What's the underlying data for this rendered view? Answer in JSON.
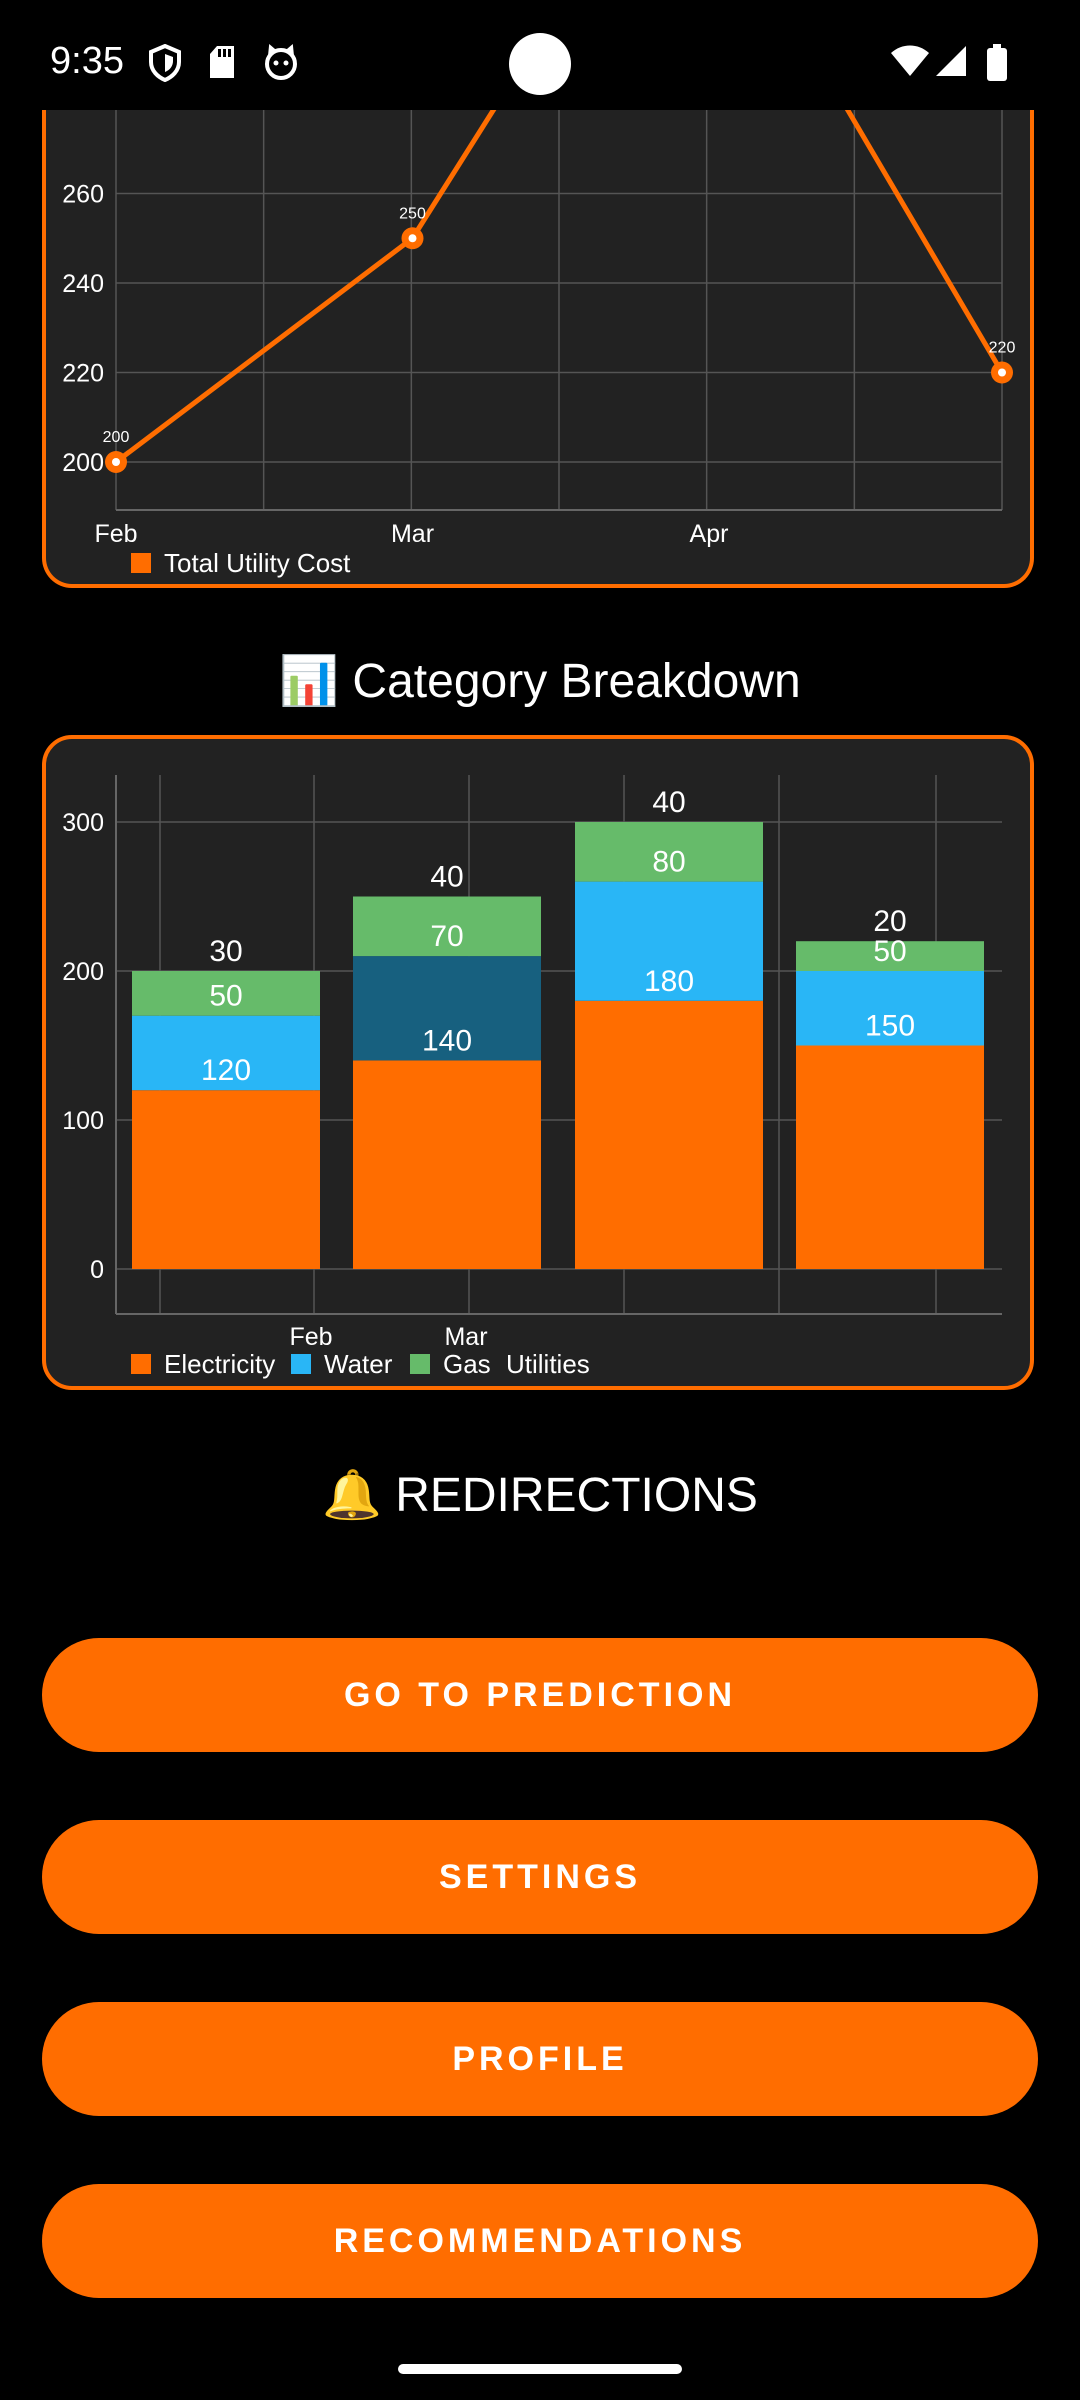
{
  "status_bar": {
    "time": "9:35",
    "left_icons": [
      "shield-icon",
      "sd-card-icon",
      "cat-face-icon"
    ],
    "right_icons": [
      "wifi-icon",
      "cell-signal-icon",
      "battery-icon"
    ]
  },
  "line_chart_card": {
    "legend_label": "Total Utility Cost"
  },
  "category_section": {
    "title": "📊 Category Breakdown"
  },
  "bar_chart_card": {
    "legend": [
      {
        "label": "Electricity",
        "color": "#ff6d00"
      },
      {
        "label": "Water",
        "color": "#29b6f6"
      },
      {
        "label": "Gas",
        "color": "#66bb6a"
      }
    ],
    "legend_suffix": "Utilities"
  },
  "redirections": {
    "title": "🔔 REDIRECTIONS",
    "buttons": {
      "prediction": "GO TO PREDICTION",
      "settings": "SETTINGS",
      "profile": "PROFILE",
      "recommendations": "RECOMMENDATIONS"
    }
  },
  "colors": {
    "accent": "#ff6d00",
    "card_bg": "#222222",
    "water": "#29b6f6",
    "water_highlight": "#17607f",
    "gas": "#66bb6a"
  },
  "chart_data": [
    {
      "type": "line",
      "xlabel": "",
      "ylabel": "",
      "x_tick_labels": [
        "Feb",
        "Mar",
        "Apr"
      ],
      "y_ticks": [
        200,
        220,
        240,
        260
      ],
      "series": [
        {
          "name": "Total Utility Cost",
          "points": [
            {
              "x": 0,
              "y": 200,
              "label": "200"
            },
            {
              "x": 1,
              "y": 250,
              "label": "250"
            },
            {
              "x": 3,
              "y": 220,
              "label": "220"
            }
          ]
        }
      ],
      "ylim_visible": [
        190,
        266
      ],
      "grid": true,
      "legend_position": "bottom-left"
    },
    {
      "type": "bar",
      "stacked": true,
      "x_tick_labels": [
        "Feb",
        "Mar"
      ],
      "y_ticks": [
        0,
        100,
        200,
        300
      ],
      "ylim": [
        0,
        330
      ],
      "series": [
        {
          "name": "Electricity",
          "values": [
            120,
            140,
            180,
            150
          ]
        },
        {
          "name": "Water",
          "values": [
            50,
            70,
            80,
            50
          ]
        },
        {
          "name": "Gas",
          "values": [
            30,
            40,
            40,
            20
          ]
        }
      ],
      "grid": true,
      "legend_position": "bottom-left"
    }
  ]
}
